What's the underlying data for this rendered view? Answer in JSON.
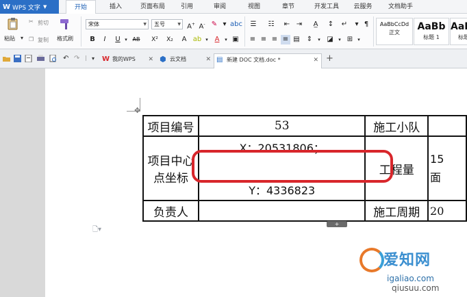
{
  "app": {
    "name": "WPS 文字"
  },
  "menu_tabs": [
    "开始",
    "插入",
    "页面布局",
    "引用",
    "审阅",
    "视图",
    "章节",
    "开发工具",
    "云服务",
    "文档助手"
  ],
  "ribbon": {
    "paste": "粘贴",
    "cut": "剪切",
    "copy": "复制",
    "format_painter": "格式刷",
    "font_name": "宋体",
    "font_size": "五号",
    "bold": "B",
    "italic": "I",
    "underline": "U",
    "strike": "AB",
    "superscript": "X²",
    "subscript": "X₂",
    "styles": [
      {
        "sample": "AaBbCcDd",
        "name": "正文"
      },
      {
        "sample": "AaBb",
        "name": "标题 1"
      },
      {
        "sample": "AaBb",
        "name": "标题"
      }
    ]
  },
  "doc_tabs": [
    {
      "label": "我的WPS",
      "active": false
    },
    {
      "label": "云文档",
      "active": false
    },
    {
      "label": "新建 DOC 文档.doc *",
      "active": true
    }
  ],
  "table": {
    "r1": {
      "a": "项目编号",
      "b": "53",
      "c": "施工小队",
      "d": ""
    },
    "r2": {
      "a_line1": "项目中心",
      "a_line2": "点坐标",
      "x": "X：20531806；",
      "y": "Y：4336823",
      "c": "工程量",
      "d_line1": "15",
      "d_line2": "面"
    },
    "r3": {
      "a": "负责人",
      "b": "",
      "c": "施工周期",
      "d": "20"
    }
  },
  "row_marker": "+",
  "watermark": {
    "brand": "爱知网",
    "domain": "igaliao.com",
    "sub": "qiusuu.com"
  }
}
